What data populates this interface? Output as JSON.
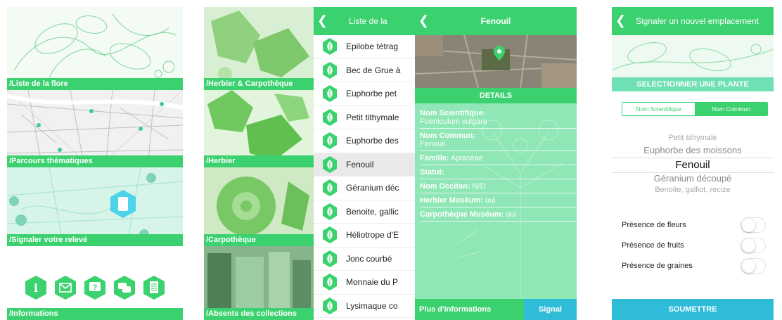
{
  "home": {
    "tiles": [
      {
        "label": "/Liste de la flore"
      },
      {
        "label": "/Parcours thématiques"
      },
      {
        "label": "/Signaler votre relevé"
      },
      {
        "label": "/Informations"
      }
    ],
    "icons": [
      "info-icon",
      "mail-icon",
      "help-icon",
      "chat-icon",
      "document-icon"
    ]
  },
  "collections": {
    "tiles": [
      {
        "label": "/Herbier & Carpothèque"
      },
      {
        "label": "/Herbier"
      },
      {
        "label": "/Carpothèque"
      },
      {
        "label": "/Absents des collections"
      }
    ]
  },
  "plant_list": {
    "title": "Liste de la",
    "items": [
      "Epilobe tétrag",
      "Bec de Grue à",
      "Euphorbe pet",
      "Petit tithymale",
      "Euphorbe des",
      "Fenouil",
      "Géranium déc",
      "Benoite, gallic",
      "Héliotrope d'E",
      "Jonc courbé",
      "Monnaie du P",
      "Lysimaque co"
    ],
    "selected_index": 5
  },
  "detail": {
    "title": "Fenouil",
    "section": "DETAILS",
    "fields": [
      {
        "label": "Nom Scientifique:",
        "value": "Foeniculum vulgare"
      },
      {
        "label": "Nom Commun:",
        "value": "Fenouil"
      },
      {
        "label": "Famille:",
        "value": "Apiaceae"
      },
      {
        "label": "Statut:",
        "value": ""
      },
      {
        "label": "Nom Occitan:",
        "value": "N/D"
      },
      {
        "label": "Herbier Muséum:",
        "value": "oui"
      },
      {
        "label": "Carpothèque Muséum:",
        "value": "oui"
      }
    ],
    "more_info": "Plus d'informations",
    "signal": "Signal"
  },
  "report": {
    "title": "Signaler un nouvel emplacement",
    "section": "SELECTIONNER UNE PLANTE",
    "seg_scientific": "Nom Scientifique",
    "seg_common": "Nom Commun",
    "picker": [
      "Petit tithymale",
      "Euphorbe des moissons",
      "Fenouil",
      "Géranium découpé",
      "Benoite, galliot, recize"
    ],
    "toggles": [
      "Présence de fleurs",
      "Présence de fruits",
      "Présence de graines"
    ],
    "submit": "SOUMETTRE"
  },
  "colors": {
    "accent": "#3bd16f",
    "secondary": "#2ebcd8"
  }
}
